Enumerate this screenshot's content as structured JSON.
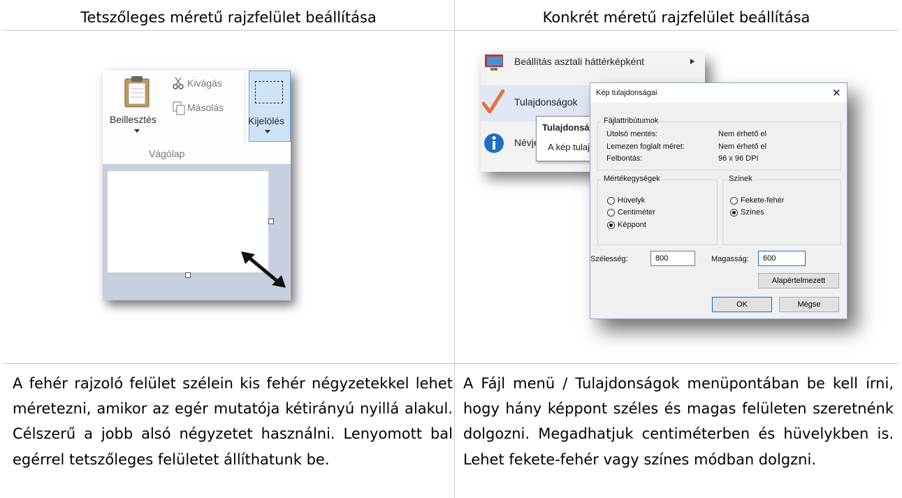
{
  "header": {
    "left_title": "Tetszőleges méretű rajzfelület beállítása",
    "right_title": "Konkrét méretű rajzfelület beállítása"
  },
  "left_screenshot": {
    "ribbon": {
      "paste_label": "Beillesztés",
      "cut_label": "Kivágás",
      "copy_label": "Másolás",
      "select_label": "Kijelölés",
      "group_label": "Vágólap"
    }
  },
  "right_screenshot": {
    "menu": {
      "item_wallpaper": "Beállítás asztali háttérképként",
      "item_properties": "Tulajdonságok",
      "item_about": "Névjegy",
      "tooltip_title": "Tulajdonságok",
      "tooltip_text": "A kép tulajdonságai"
    },
    "dialog": {
      "title": "Kép tulajdonságai",
      "close_glyph": "✕",
      "attributes_group": "Fájlattribútumok",
      "last_saved_label": "Utolsó mentés:",
      "last_saved_value": "Nem érhető el",
      "disk_size_label": "Lemezen foglalt méret:",
      "disk_size_value": "Nem érhető el",
      "resolution_label": "Felbontás:",
      "resolution_value": "96 x 96 DPI",
      "units_group": "Mértékegységek",
      "unit_inch": "Hüvelyk",
      "unit_cm": "Centiméter",
      "unit_pixel": "Képpont",
      "selected_unit": "Képpont",
      "colors_group": "Színek",
      "color_bw": "Fekete-fehér",
      "color_color": "Színes",
      "selected_color": "Színes",
      "width_label": "Szélesség:",
      "width_value": "800",
      "height_label": "Magasság:",
      "height_value": "600",
      "default_button": "Alapértelmezett",
      "ok_button": "OK",
      "cancel_button": "Mégse"
    }
  },
  "descriptions": {
    "left": "A fehér rajzoló felület szélein kis fehér négyzetekkel lehet méretezni, amikor az egér mutatója kétirányú nyillá alakul. Célszerű a jobb alsó négyzetet használni. Lenyomott bal egérrel tetszőleges felületet állíthatunk be.",
    "right": "A Fájl menü / Tulajdonságok menüpontában be kell írni, hogy hány képpont széles és magas felületen szeretnénk dolgozni. Megadhatjuk centiméterben és hüvelykben is. Lehet fekete-fehér vagy színes módban dolgzni."
  },
  "colors": {
    "workarea": "#c6d0de",
    "selection_blue": "#cfe3f7",
    "checkmark": "#e8713a",
    "info_icon": "#1f6fc6",
    "grid_line": "#c9c9c9"
  }
}
